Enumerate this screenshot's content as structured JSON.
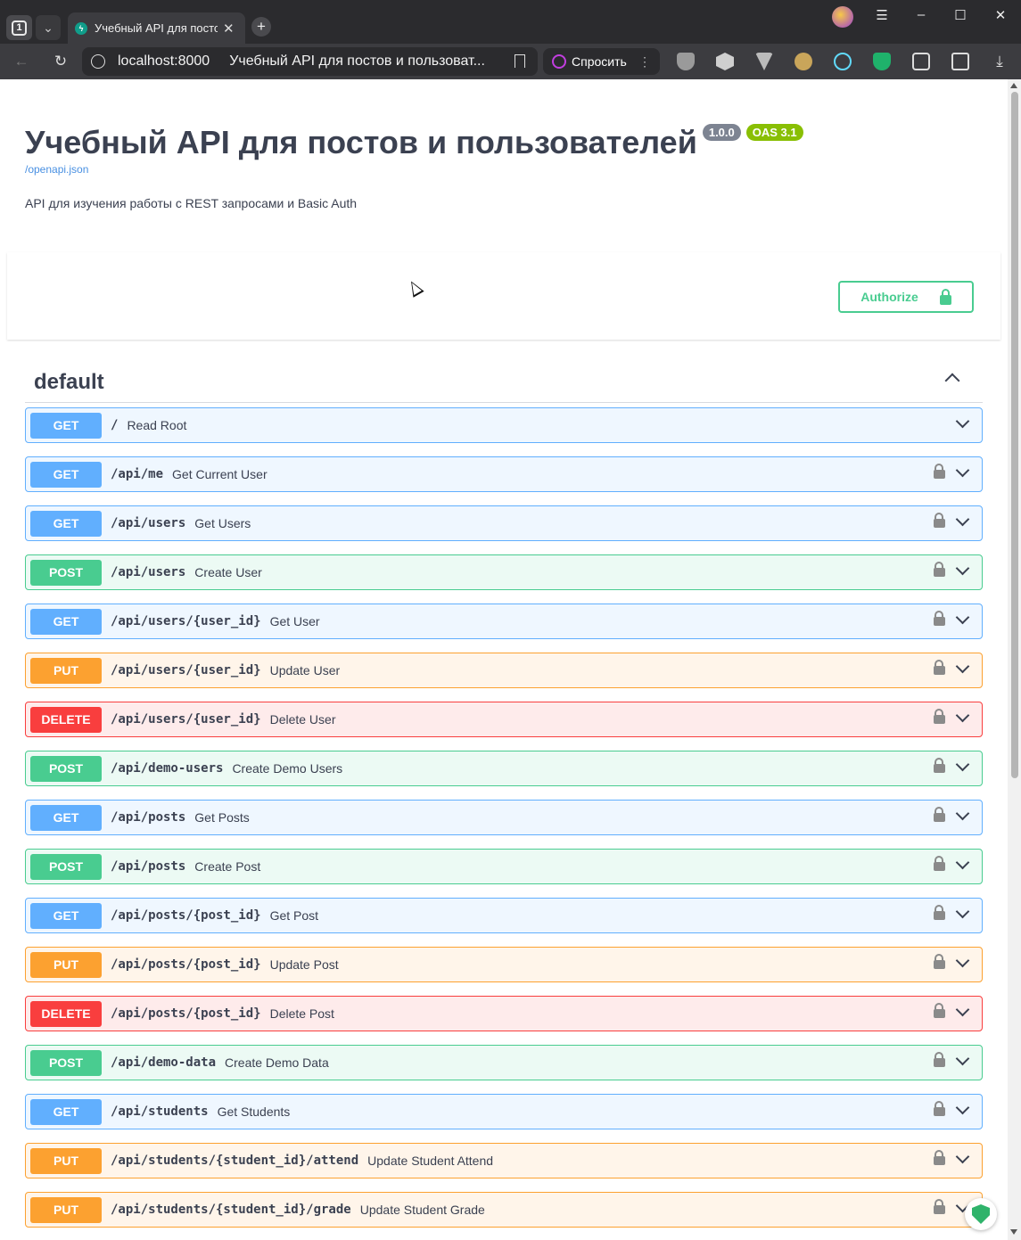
{
  "browser": {
    "tab_count": "1",
    "tab_title": "Учебный API для постов и пользователей",
    "url": "localhost:8000",
    "page_title": "Учебный API для постов и пользоват...",
    "ask_label": "Спросить",
    "ask_menu": "⋮"
  },
  "info": {
    "title": "Учебный API для постов и пользователей",
    "version": "1.0.0",
    "oas": "OAS 3.1",
    "spec_link": "/openapi.json",
    "description": "API для изучения работы с REST запросами и Basic Auth"
  },
  "authorize_label": "Authorize",
  "tag": {
    "name": "default"
  },
  "operations": [
    {
      "method": "GET",
      "path": "/",
      "summary": "Read Root",
      "locked": false
    },
    {
      "method": "GET",
      "path": "/api/me",
      "summary": "Get Current User",
      "locked": true
    },
    {
      "method": "GET",
      "path": "/api/users",
      "summary": "Get Users",
      "locked": true
    },
    {
      "method": "POST",
      "path": "/api/users",
      "summary": "Create User",
      "locked": true
    },
    {
      "method": "GET",
      "path": "/api/users/{user_id}",
      "summary": "Get User",
      "locked": true
    },
    {
      "method": "PUT",
      "path": "/api/users/{user_id}",
      "summary": "Update User",
      "locked": true
    },
    {
      "method": "DELETE",
      "path": "/api/users/{user_id}",
      "summary": "Delete User",
      "locked": true
    },
    {
      "method": "POST",
      "path": "/api/demo-users",
      "summary": "Create Demo Users",
      "locked": true
    },
    {
      "method": "GET",
      "path": "/api/posts",
      "summary": "Get Posts",
      "locked": true
    },
    {
      "method": "POST",
      "path": "/api/posts",
      "summary": "Create Post",
      "locked": true
    },
    {
      "method": "GET",
      "path": "/api/posts/{post_id}",
      "summary": "Get Post",
      "locked": true
    },
    {
      "method": "PUT",
      "path": "/api/posts/{post_id}",
      "summary": "Update Post",
      "locked": true
    },
    {
      "method": "DELETE",
      "path": "/api/posts/{post_id}",
      "summary": "Delete Post",
      "locked": true
    },
    {
      "method": "POST",
      "path": "/api/demo-data",
      "summary": "Create Demo Data",
      "locked": true
    },
    {
      "method": "GET",
      "path": "/api/students",
      "summary": "Get Students",
      "locked": true
    },
    {
      "method": "PUT",
      "path": "/api/students/{student_id}/attend",
      "summary": "Update Student Attend",
      "locked": true
    },
    {
      "method": "PUT",
      "path": "/api/students/{student_id}/grade",
      "summary": "Update Student Grade",
      "locked": true
    }
  ],
  "colors": {
    "get": "#61affe",
    "post": "#49cc90",
    "put": "#fca130",
    "delete": "#f93e3e",
    "version_badge": "#7d8492",
    "oas_badge": "#89bf04"
  }
}
